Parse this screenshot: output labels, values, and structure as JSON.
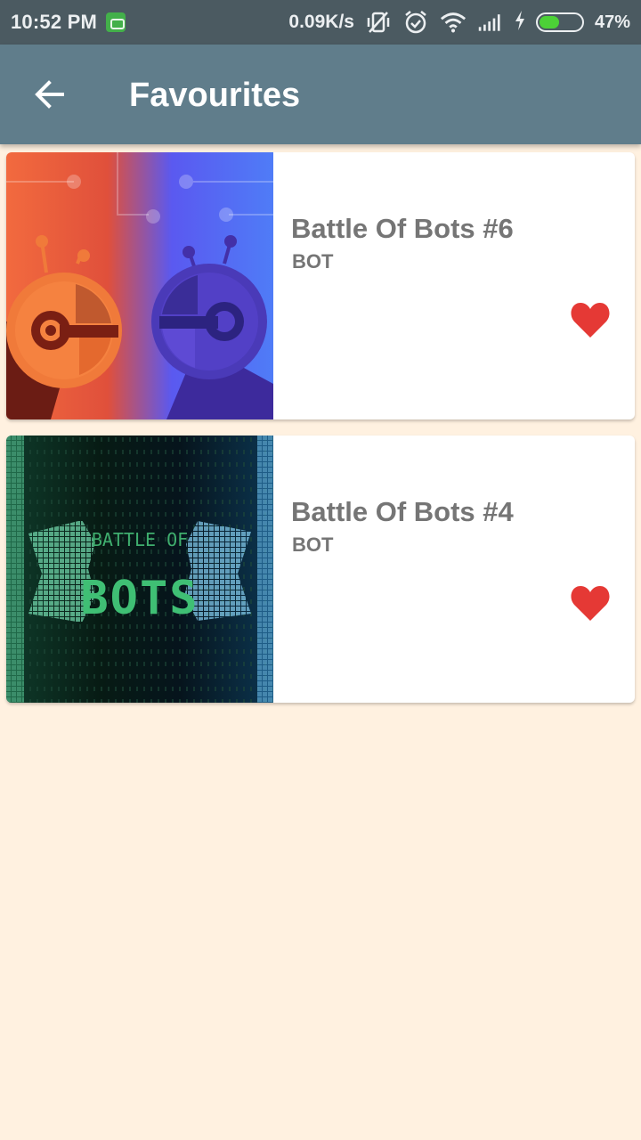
{
  "status_bar": {
    "time": "10:52 PM",
    "net_speed": "0.09K/s",
    "battery_percent": "47%",
    "battery_level": 0.47,
    "icons": [
      "app-notification-icon",
      "vibrate-off-icon",
      "alarm-icon",
      "wifi-icon",
      "signal-icon",
      "charging-icon",
      "battery-icon"
    ]
  },
  "app_bar": {
    "title": "Favourites",
    "back_icon": "arrow-back-icon",
    "color": "#607D8B"
  },
  "favourites": [
    {
      "title": "Battle Of Bots #6",
      "category": "BOT",
      "favourite_icon": "heart-icon",
      "image": "battle-of-bots-6-thumbnail"
    },
    {
      "title": "Battle Of Bots #4",
      "category": "BOT",
      "favourite_icon": "heart-icon",
      "image": "battle-of-bots-4-thumbnail",
      "image_text": {
        "line1": "BATTLE OF",
        "line2": "BOTS"
      }
    }
  ],
  "colors": {
    "background": "#FFF1E0",
    "heart": "#E53935",
    "text": "#757575",
    "status_bar": "#4B5A61"
  }
}
